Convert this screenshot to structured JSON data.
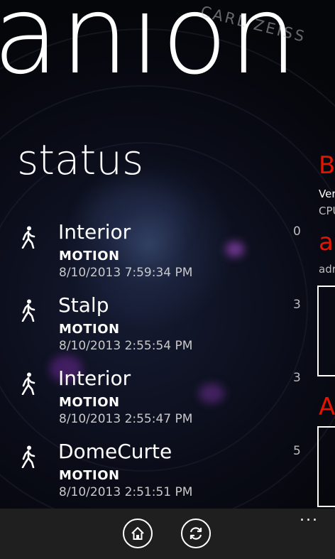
{
  "app": {
    "panorama_title": "anion",
    "lens_brand": "CARL ZEISS"
  },
  "section": {
    "title": "status"
  },
  "events": [
    {
      "name": "Interior",
      "type": "MOTION",
      "time": "8/10/2013 7:59:34 PM",
      "count": "0",
      "icon": "walking-person-icon"
    },
    {
      "name": "Stalp",
      "type": "MOTION",
      "time": "8/10/2013 2:55:54 PM",
      "count": "3",
      "icon": "walking-person-icon"
    },
    {
      "name": "Interior",
      "type": "MOTION",
      "time": "8/10/2013 2:55:47 PM",
      "count": "3",
      "icon": "walking-person-icon"
    },
    {
      "name": "DomeCurte",
      "type": "MOTION",
      "time": "8/10/2013 2:51:51 PM",
      "count": "5",
      "icon": "walking-person-icon"
    }
  ],
  "peek": {
    "head1": "B",
    "line1": "Ver",
    "line2": "CPU",
    "head2": "a",
    "line3": "adr",
    "box1_chars": [
      "(",
      "(",
      "("
    ],
    "head3": "A",
    "box2_chars": [
      "<"
    ]
  },
  "app_bar": {
    "home_icon": "home-icon",
    "refresh_icon": "refresh-icon",
    "more": "..."
  },
  "colors": {
    "accent": "#e51400",
    "app_bar_bg": "#1f1f1f",
    "background": "#05060a"
  }
}
